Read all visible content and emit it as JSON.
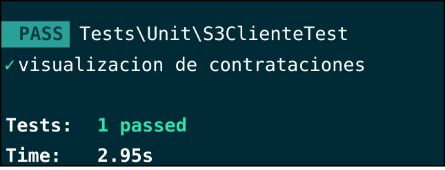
{
  "result": {
    "badge": "PASS",
    "test_class": "Tests\\Unit\\S3ClienteTest"
  },
  "test_case": {
    "status_icon": "check-icon",
    "check_glyph": "✓",
    "name": "visualizacion de contrataciones"
  },
  "summary": {
    "tests_label": "Tests:",
    "tests_value": "1 passed",
    "time_label": "Time:",
    "time_value": "2.95s"
  },
  "colors": {
    "background": "#002b36",
    "badge_bg": "#2aa198",
    "success": "#2ee5b0"
  }
}
